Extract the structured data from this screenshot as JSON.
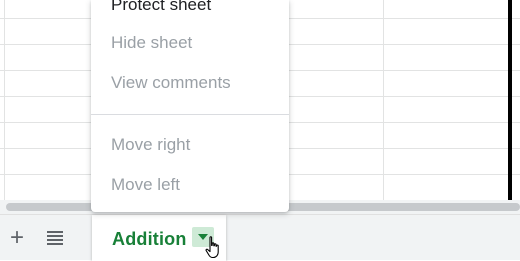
{
  "menu": {
    "items": [
      {
        "label": "Protect sheet",
        "enabled": true
      },
      {
        "label": "Hide sheet",
        "enabled": false
      },
      {
        "label": "View comments",
        "enabled": false
      },
      {
        "label": "Move right",
        "enabled": false
      },
      {
        "label": "Move left",
        "enabled": false
      }
    ]
  },
  "sheet_bar": {
    "add_icon": "plus-icon",
    "list_icon": "sheet-list-icon",
    "active_tab": {
      "label": "Addition",
      "color": "#188038",
      "arrow_icon": "chevron-down-icon"
    }
  },
  "colors": {
    "accent": "#188038",
    "arrow_bg": "#ceead6",
    "disabled_text": "#9aa0a6",
    "enabled_text": "#202124"
  },
  "cursor_icon": "hand-pointer-icon"
}
